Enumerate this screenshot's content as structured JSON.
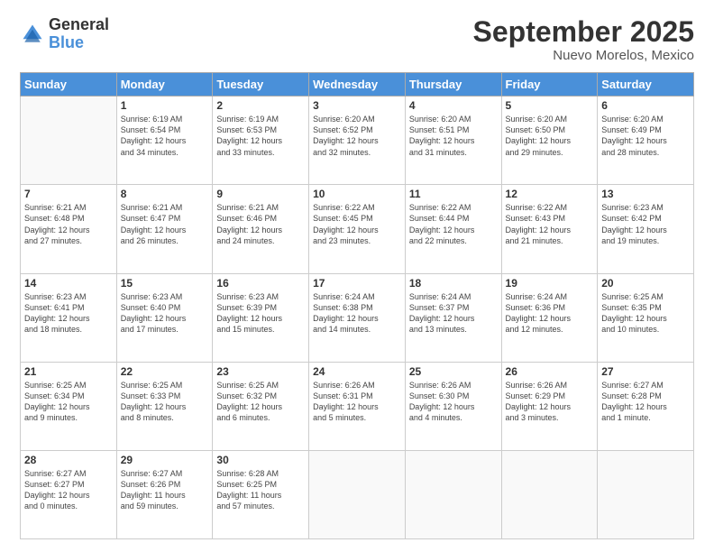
{
  "logo": {
    "general": "General",
    "blue": "Blue"
  },
  "header": {
    "title": "September 2025",
    "subtitle": "Nuevo Morelos, Mexico"
  },
  "days_of_week": [
    "Sunday",
    "Monday",
    "Tuesday",
    "Wednesday",
    "Thursday",
    "Friday",
    "Saturday"
  ],
  "weeks": [
    [
      {
        "day": "",
        "detail": ""
      },
      {
        "day": "1",
        "detail": "Sunrise: 6:19 AM\nSunset: 6:54 PM\nDaylight: 12 hours\nand 34 minutes."
      },
      {
        "day": "2",
        "detail": "Sunrise: 6:19 AM\nSunset: 6:53 PM\nDaylight: 12 hours\nand 33 minutes."
      },
      {
        "day": "3",
        "detail": "Sunrise: 6:20 AM\nSunset: 6:52 PM\nDaylight: 12 hours\nand 32 minutes."
      },
      {
        "day": "4",
        "detail": "Sunrise: 6:20 AM\nSunset: 6:51 PM\nDaylight: 12 hours\nand 31 minutes."
      },
      {
        "day": "5",
        "detail": "Sunrise: 6:20 AM\nSunset: 6:50 PM\nDaylight: 12 hours\nand 29 minutes."
      },
      {
        "day": "6",
        "detail": "Sunrise: 6:20 AM\nSunset: 6:49 PM\nDaylight: 12 hours\nand 28 minutes."
      }
    ],
    [
      {
        "day": "7",
        "detail": "Sunrise: 6:21 AM\nSunset: 6:48 PM\nDaylight: 12 hours\nand 27 minutes."
      },
      {
        "day": "8",
        "detail": "Sunrise: 6:21 AM\nSunset: 6:47 PM\nDaylight: 12 hours\nand 26 minutes."
      },
      {
        "day": "9",
        "detail": "Sunrise: 6:21 AM\nSunset: 6:46 PM\nDaylight: 12 hours\nand 24 minutes."
      },
      {
        "day": "10",
        "detail": "Sunrise: 6:22 AM\nSunset: 6:45 PM\nDaylight: 12 hours\nand 23 minutes."
      },
      {
        "day": "11",
        "detail": "Sunrise: 6:22 AM\nSunset: 6:44 PM\nDaylight: 12 hours\nand 22 minutes."
      },
      {
        "day": "12",
        "detail": "Sunrise: 6:22 AM\nSunset: 6:43 PM\nDaylight: 12 hours\nand 21 minutes."
      },
      {
        "day": "13",
        "detail": "Sunrise: 6:23 AM\nSunset: 6:42 PM\nDaylight: 12 hours\nand 19 minutes."
      }
    ],
    [
      {
        "day": "14",
        "detail": "Sunrise: 6:23 AM\nSunset: 6:41 PM\nDaylight: 12 hours\nand 18 minutes."
      },
      {
        "day": "15",
        "detail": "Sunrise: 6:23 AM\nSunset: 6:40 PM\nDaylight: 12 hours\nand 17 minutes."
      },
      {
        "day": "16",
        "detail": "Sunrise: 6:23 AM\nSunset: 6:39 PM\nDaylight: 12 hours\nand 15 minutes."
      },
      {
        "day": "17",
        "detail": "Sunrise: 6:24 AM\nSunset: 6:38 PM\nDaylight: 12 hours\nand 14 minutes."
      },
      {
        "day": "18",
        "detail": "Sunrise: 6:24 AM\nSunset: 6:37 PM\nDaylight: 12 hours\nand 13 minutes."
      },
      {
        "day": "19",
        "detail": "Sunrise: 6:24 AM\nSunset: 6:36 PM\nDaylight: 12 hours\nand 12 minutes."
      },
      {
        "day": "20",
        "detail": "Sunrise: 6:25 AM\nSunset: 6:35 PM\nDaylight: 12 hours\nand 10 minutes."
      }
    ],
    [
      {
        "day": "21",
        "detail": "Sunrise: 6:25 AM\nSunset: 6:34 PM\nDaylight: 12 hours\nand 9 minutes."
      },
      {
        "day": "22",
        "detail": "Sunrise: 6:25 AM\nSunset: 6:33 PM\nDaylight: 12 hours\nand 8 minutes."
      },
      {
        "day": "23",
        "detail": "Sunrise: 6:25 AM\nSunset: 6:32 PM\nDaylight: 12 hours\nand 6 minutes."
      },
      {
        "day": "24",
        "detail": "Sunrise: 6:26 AM\nSunset: 6:31 PM\nDaylight: 12 hours\nand 5 minutes."
      },
      {
        "day": "25",
        "detail": "Sunrise: 6:26 AM\nSunset: 6:30 PM\nDaylight: 12 hours\nand 4 minutes."
      },
      {
        "day": "26",
        "detail": "Sunrise: 6:26 AM\nSunset: 6:29 PM\nDaylight: 12 hours\nand 3 minutes."
      },
      {
        "day": "27",
        "detail": "Sunrise: 6:27 AM\nSunset: 6:28 PM\nDaylight: 12 hours\nand 1 minute."
      }
    ],
    [
      {
        "day": "28",
        "detail": "Sunrise: 6:27 AM\nSunset: 6:27 PM\nDaylight: 12 hours\nand 0 minutes."
      },
      {
        "day": "29",
        "detail": "Sunrise: 6:27 AM\nSunset: 6:26 PM\nDaylight: 11 hours\nand 59 minutes."
      },
      {
        "day": "30",
        "detail": "Sunrise: 6:28 AM\nSunset: 6:25 PM\nDaylight: 11 hours\nand 57 minutes."
      },
      {
        "day": "",
        "detail": ""
      },
      {
        "day": "",
        "detail": ""
      },
      {
        "day": "",
        "detail": ""
      },
      {
        "day": "",
        "detail": ""
      }
    ]
  ]
}
